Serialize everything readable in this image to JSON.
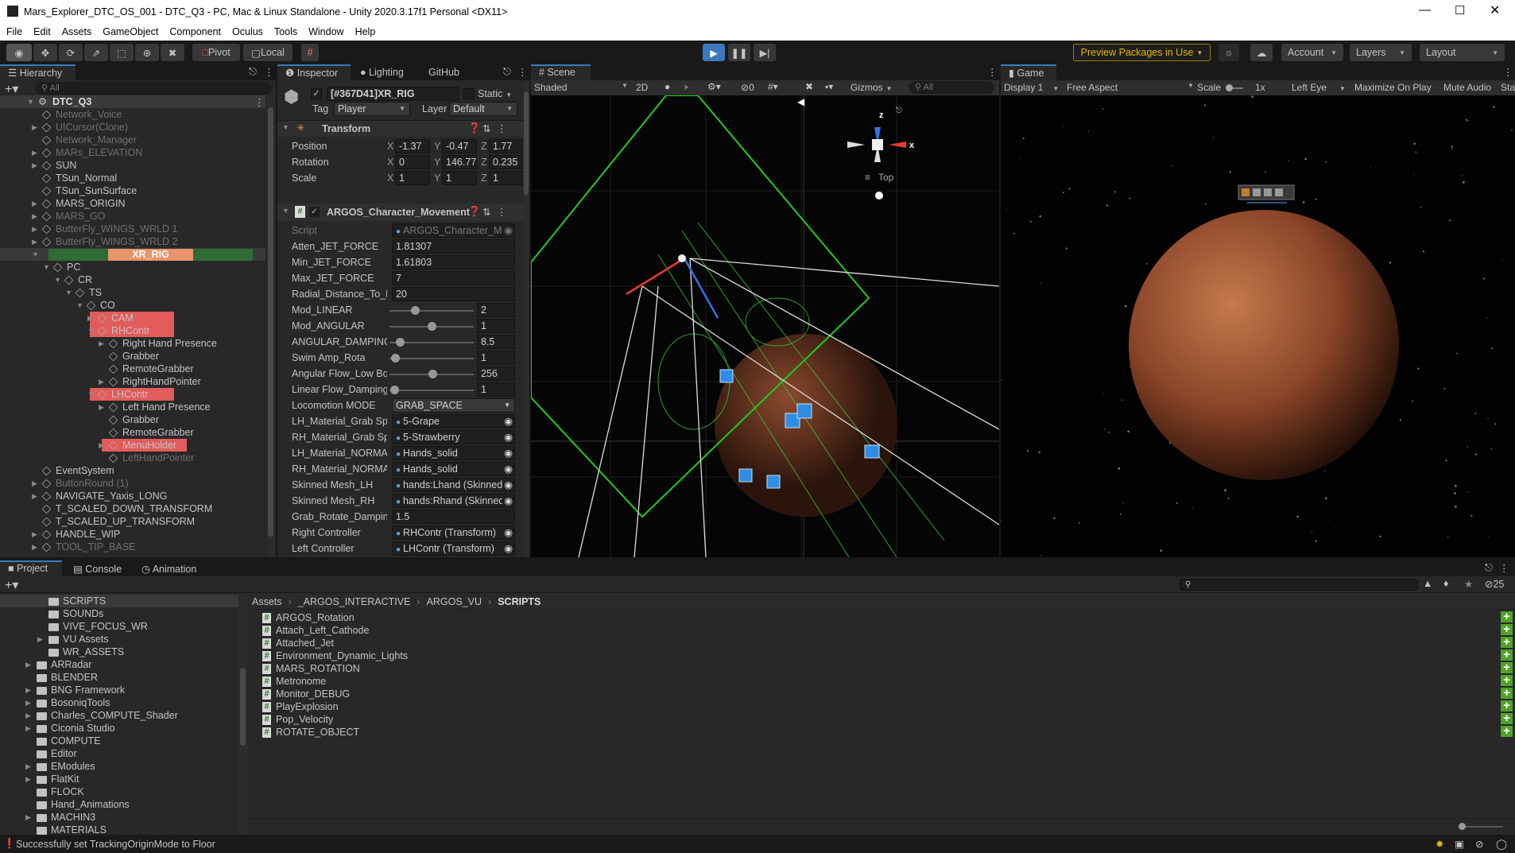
{
  "window": {
    "title": "Mars_Explorer_DTC_OS_001 - DTC_Q3 - PC, Mac & Linux Standalone - Unity 2020.3.17f1 Personal <DX11>"
  },
  "menu": [
    "File",
    "Edit",
    "Assets",
    "GameObject",
    "Component",
    "Oculus",
    "Tools",
    "Window",
    "Help"
  ],
  "toolbar": {
    "pivot": "Pivot",
    "local": "Local",
    "preview_packages": "Preview Packages in Use",
    "account": "Account",
    "layers": "Layers",
    "layout": "Layout",
    "accent": "#3a79bb",
    "preview_color": "#e6b400"
  },
  "hierarchy": {
    "tab": "Hierarchy",
    "search_placeholder": "All",
    "scene": "DTC_Q3",
    "items": [
      {
        "label": "Network_Voice",
        "depth": 1,
        "arrow": "none",
        "dim": true
      },
      {
        "label": "UICursor(Clone)",
        "depth": 1,
        "arrow": "collapsed",
        "dim": true
      },
      {
        "label": "Network_Manager",
        "depth": 1,
        "arrow": "none",
        "dim": true
      },
      {
        "label": "MARs_ELEVATION",
        "depth": 1,
        "arrow": "collapsed",
        "dim": true
      },
      {
        "label": "SUN",
        "depth": 1,
        "arrow": "collapsed"
      },
      {
        "label": "TSun_Normal",
        "depth": 1,
        "arrow": "none"
      },
      {
        "label": "TSun_SunSurface",
        "depth": 1,
        "arrow": "none"
      },
      {
        "label": "MARS_ORIGIN",
        "depth": 1,
        "arrow": "collapsed"
      },
      {
        "label": "MARS_GO",
        "depth": 1,
        "arrow": "collapsed",
        "dim": true
      },
      {
        "label": "ButterFly_WINGS_WRLD 1",
        "depth": 1,
        "arrow": "collapsed",
        "dim": true
      },
      {
        "label": "ButterFly_WINGS_WRLD 2",
        "depth": 1,
        "arrow": "collapsed",
        "dim": true
      },
      {
        "label": "XR_RIG",
        "depth": 1,
        "arrow": "expanded",
        "special": "xr"
      },
      {
        "label": "PC",
        "depth": 2,
        "arrow": "expanded"
      },
      {
        "label": "CR",
        "depth": 3,
        "arrow": "expanded"
      },
      {
        "label": "TS",
        "depth": 4,
        "arrow": "expanded"
      },
      {
        "label": "CO",
        "depth": 5,
        "arrow": "expanded"
      },
      {
        "label": "CAM",
        "depth": 6,
        "arrow": "collapsed",
        "special": "red"
      },
      {
        "label": "RHContr",
        "depth": 6,
        "arrow": "expanded",
        "special": "red"
      },
      {
        "label": "Right Hand Presence",
        "depth": 7,
        "arrow": "collapsed"
      },
      {
        "label": "Grabber",
        "depth": 7,
        "arrow": "none"
      },
      {
        "label": "RemoteGrabber",
        "depth": 7,
        "arrow": "none"
      },
      {
        "label": "RightHandPointer",
        "depth": 7,
        "arrow": "collapsed"
      },
      {
        "label": "LHContr",
        "depth": 6,
        "arrow": "expanded",
        "special": "red"
      },
      {
        "label": "Left Hand Presence",
        "depth": 7,
        "arrow": "collapsed"
      },
      {
        "label": "Grabber",
        "depth": 7,
        "arrow": "none"
      },
      {
        "label": "RemoteGrabber",
        "depth": 7,
        "arrow": "none"
      },
      {
        "label": "MenuHolder",
        "depth": 7,
        "arrow": "collapsed",
        "special": "red2"
      },
      {
        "label": "LeftHandPointer",
        "depth": 7,
        "arrow": "none",
        "dim": true
      },
      {
        "label": "EventSystem",
        "depth": 1,
        "arrow": "none"
      },
      {
        "label": "ButtonRound (1)",
        "depth": 1,
        "arrow": "collapsed",
        "dim": true
      },
      {
        "label": "NAVIGATE_Yaxis_LONG",
        "depth": 1,
        "arrow": "collapsed"
      },
      {
        "label": "T_SCALED_DOWN_TRANSFORM",
        "depth": 1,
        "arrow": "none"
      },
      {
        "label": "T_SCALED_UP_TRANSFORM",
        "depth": 1,
        "arrow": "none"
      },
      {
        "label": "HANDLE_WIP",
        "depth": 1,
        "arrow": "collapsed"
      },
      {
        "label": "TOOL_TIP_BASE",
        "depth": 1,
        "arrow": "collapsed",
        "dim": true
      }
    ],
    "colors": {
      "xr_bar": "#2e6b35",
      "xr_label": "#e8956a",
      "highlight": "#e25c5c"
    }
  },
  "inspector": {
    "tabs": [
      "Inspector",
      "Lighting",
      "GitHub"
    ],
    "object_name": "[#367D41]XR_RIG",
    "static_label": "Static",
    "tag_label": "Tag",
    "tag": "Player",
    "layer_label": "Layer",
    "layer": "Default",
    "transform": {
      "title": "Transform",
      "rows": [
        {
          "label": "Position",
          "x": "-1.37",
          "y": "-0.47",
          "z": "1.77"
        },
        {
          "label": "Rotation",
          "x": "0",
          "y": "146.77",
          "z": "0.235"
        },
        {
          "label": "Scale",
          "x": "1",
          "y": "1",
          "z": "1"
        }
      ]
    },
    "component": {
      "title": "ARGOS_Character_Movement",
      "fields": [
        {
          "label": "Script",
          "value": "ARGOS_Character_Mo",
          "kind": "object",
          "dim": true
        },
        {
          "label": "Atten_JET_FORCE",
          "value": "1.81307",
          "kind": "text"
        },
        {
          "label": "Min_JET_FORCE",
          "value": "1.61803",
          "kind": "text"
        },
        {
          "label": "Max_JET_FORCE",
          "value": "7",
          "kind": "text"
        },
        {
          "label": "Radial_Distance_To_M",
          "value": "20",
          "kind": "text"
        },
        {
          "label": "Mod_LINEAR",
          "value": "2",
          "kind": "slider",
          "level": 0.3
        },
        {
          "label": "Mod_ANGULAR",
          "value": "1",
          "kind": "slider",
          "level": 0.5
        },
        {
          "label": "ANGULAR_DAMPING",
          "value": "8.5",
          "kind": "slider",
          "level": 0.12
        },
        {
          "label": "Swim Amp_Rota",
          "value": "1",
          "kind": "slider",
          "level": 0.07
        },
        {
          "label": "Angular Flow_Low Bo",
          "value": "256",
          "kind": "slider",
          "level": 0.51
        },
        {
          "label": "Linear Flow_Damping",
          "value": "1",
          "kind": "slider",
          "level": 0.06
        },
        {
          "label": "Locomotion MODE",
          "value": "GRAB_SPACE",
          "kind": "dropdown"
        },
        {
          "label": "LH_Material_Grab Spa",
          "value": "5-Grape",
          "kind": "object"
        },
        {
          "label": "RH_Material_Grab Sp",
          "value": "5-Strawberry",
          "kind": "object"
        },
        {
          "label": "LH_Material_NORMAL",
          "value": "Hands_solid",
          "kind": "object"
        },
        {
          "label": "RH_Material_NORMA",
          "value": "Hands_solid",
          "kind": "object"
        },
        {
          "label": "Skinned Mesh_LH",
          "value": "hands:Lhand (Skinned",
          "kind": "object"
        },
        {
          "label": "Skinned Mesh_RH",
          "value": "hands:Rhand (Skinned",
          "kind": "object"
        },
        {
          "label": "Grab_Rotate_Damping",
          "value": "1.5",
          "kind": "text"
        },
        {
          "label": "Right Controller",
          "value": "RHContr (Transform)",
          "kind": "object"
        },
        {
          "label": "Left Controller",
          "value": "LHContr (Transform)",
          "kind": "object"
        }
      ]
    }
  },
  "scene": {
    "tab": "Scene",
    "shading": "Shaded",
    "mode_2d": "2D",
    "hidden_count": "0",
    "gizmos": "Gizmos",
    "search_placeholder": "All",
    "view_label": "Top",
    "axis_x": "x",
    "axis_z": "z"
  },
  "game": {
    "tab": "Game",
    "display": "Display 1",
    "aspect": "Free Aspect",
    "scale_label": "Scale",
    "scale_value": "1x",
    "eye": "Left Eye",
    "maximize": "Maximize On Play",
    "mute": "Mute Audio",
    "stats": "Sta"
  },
  "bottom": {
    "tabs": [
      "Project",
      "Console",
      "Animation"
    ],
    "hidden_count": "25",
    "folders": [
      {
        "label": "SCRIPTS",
        "depth": 2,
        "arrow": false,
        "selected": true
      },
      {
        "label": "SOUNDs",
        "depth": 2,
        "arrow": false
      },
      {
        "label": "VIVE_FOCUS_WR",
        "depth": 2,
        "arrow": false
      },
      {
        "label": "VU Assets",
        "depth": 2,
        "arrow": true
      },
      {
        "label": "WR_ASSETS",
        "depth": 2,
        "arrow": false
      },
      {
        "label": "ARRadar",
        "depth": 1,
        "arrow": true
      },
      {
        "label": "BLENDER",
        "depth": 1,
        "arrow": false
      },
      {
        "label": "BNG Framework",
        "depth": 1,
        "arrow": true
      },
      {
        "label": "BosoniqTools",
        "depth": 1,
        "arrow": true
      },
      {
        "label": "Charles_COMPUTE_Shader",
        "depth": 1,
        "arrow": true
      },
      {
        "label": "Ciconia Studio",
        "depth": 1,
        "arrow": true
      },
      {
        "label": "COMPUTE",
        "depth": 1,
        "arrow": false
      },
      {
        "label": "Editor",
        "depth": 1,
        "arrow": false
      },
      {
        "label": "EModules",
        "depth": 1,
        "arrow": true
      },
      {
        "label": "FlatKit",
        "depth": 1,
        "arrow": true
      },
      {
        "label": "FLOCK",
        "depth": 1,
        "arrow": false
      },
      {
        "label": "Hand_Animations",
        "depth": 1,
        "arrow": false
      },
      {
        "label": "MACHIN3",
        "depth": 1,
        "arrow": true
      },
      {
        "label": "MATERIALS",
        "depth": 1,
        "arrow": false
      }
    ],
    "breadcrumb": [
      "Assets",
      "_ARGOS_INTERACTIVE",
      "ARGOS_VU",
      "SCRIPTS"
    ],
    "scripts": [
      "ARGOS_Rotation",
      "Attach_Left_Cathode",
      "Attached_Jet",
      "Environment_Dynamic_Lights",
      "MARS_ROTATION",
      "Metronome",
      "Monitor_DEBUG",
      "PlayExplosion",
      "Pop_Velocity",
      "ROTATE_OBJECT"
    ]
  },
  "status": {
    "message": "Successfully set TrackingOriginMode to Floor"
  }
}
